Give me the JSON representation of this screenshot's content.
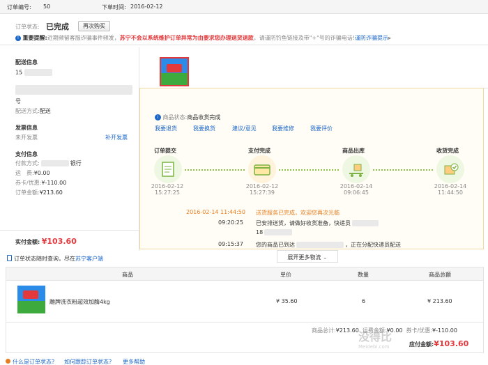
{
  "header": {
    "order_no_label": "订单编号:",
    "order_no_value": "50",
    "order_time_label": "下单时间:",
    "order_time_value": "2016-02-12"
  },
  "status": {
    "label": "订单状态:",
    "value": "已完成",
    "rebuy_label": "再次购买",
    "notice_label": "重要提醒:",
    "notice_text": "近期频留客服诈骗事件频发，",
    "notice_warning": "苏宁不会以系统维护订单异常为由要求您办理退货退款",
    "notice_tail": "，请谨防钓鱼链接及带\"+\"号的诈骗电话!",
    "notice_link": "谨防诈骗提示"
  },
  "delivery": {
    "title": "配送信息",
    "line1": "15",
    "line3": "号",
    "method_label": "配送方式:",
    "method_value": "配送"
  },
  "invoice": {
    "title": "发票信息",
    "status": "未开发票",
    "action": "补开发票"
  },
  "payment": {
    "title": "支付信息",
    "method_label": "付款方式:",
    "method_value": "银行",
    "freight_label": "运　费:",
    "freight_value": "¥0.00",
    "coupon_label": "券卡/优惠:",
    "coupon_value": "¥-110.00",
    "total_label": "订单金额:",
    "total_value": "¥213.60",
    "paid_label": "实付金额:",
    "paid_value": "¥103.60"
  },
  "goods_status": {
    "label": "商品状态:",
    "value": "商品收货完成",
    "actions": [
      "我要退货",
      "我要换货",
      "建议/意见",
      "我要维修",
      "我要评价"
    ]
  },
  "steps": [
    {
      "title": "订单提交",
      "date": "2016-02-12",
      "time": "15:27:25"
    },
    {
      "title": "支付完成",
      "date": "2016-02-12",
      "time": "15:27:39"
    },
    {
      "title": "商品出库",
      "date": "2016-02-14",
      "time": "09:06:45"
    },
    {
      "title": "收货完成",
      "date": "2016-02-14",
      "time": "11:44:50"
    }
  ],
  "logistics": [
    {
      "time": "2016-02-14 11:44:50",
      "text": "送货服务已完成，欢迎您再次光临"
    },
    {
      "time": "09:20:25",
      "text": "已安排送货，请做好收货准备，快递员",
      "sub": "18"
    },
    {
      "time": "09:15:37",
      "text": "您的商品已到达",
      "tail": "，正在分配快递员配送"
    }
  ],
  "expand_label": "展开更多物流",
  "tip": {
    "text": "订单状态随时查询，尽在",
    "link": "苏宁客户端"
  },
  "table": {
    "headers": [
      "商品",
      "单价",
      "数量",
      "商品总额"
    ],
    "row": {
      "name": "雕牌洗衣粉超效加酶4kg",
      "price": "¥ 35.60",
      "qty": "6",
      "total": "¥ 213.60"
    }
  },
  "summary": {
    "goods_total_label": "商品总计:",
    "goods_total_value": "¥213.60",
    "freight_label": "运费金额:",
    "freight_value": "¥0.00",
    "coupon_label": "券卡/优惠:",
    "coupon_value": "¥-110.00",
    "pay_label": "应付金额:",
    "pay_value": "¥103.60"
  },
  "faq": {
    "q1": "什么是订单状态?",
    "q2": "如何跟踪订单状态?",
    "q3": "更多帮助"
  },
  "watermark": {
    "text": "没得比",
    "domain": "Meidebi.com"
  }
}
